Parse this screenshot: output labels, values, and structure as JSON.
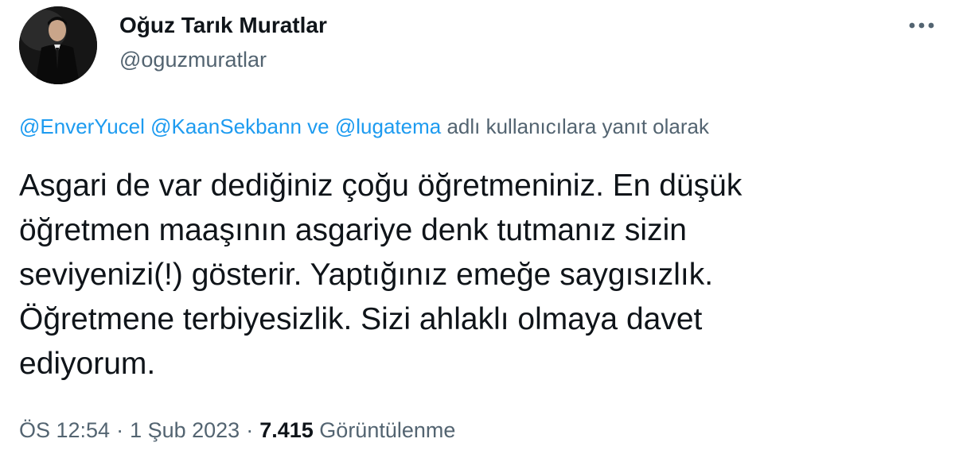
{
  "author": {
    "display_name": "Oğuz Tarık Muratlar",
    "handle": "@oguzmuratlar"
  },
  "menu": {
    "icon": "more-horizontal-icon"
  },
  "reply": {
    "mentions": [
      "@EnverYucel",
      "@KaanSekbann",
      "@lugatema"
    ],
    "connector": "ve",
    "suffix": "adlı kullanıcılara yanıt olarak"
  },
  "tweet": {
    "lines": [
      "Asgari de var dediğiniz çoğu öğretmeniniz. En düşük",
      "öğretmen maaşının asgariye denk tutmanız sizin",
      "seviyenizi(!) gösterir. Yaptığınız emeğe saygısızlık.",
      "Öğretmene terbiyesizlik. Sizi ahlaklı olmaya davet",
      "ediyorum."
    ]
  },
  "meta": {
    "time": "ÖS 12:54",
    "separator": "·",
    "date": "1 Şub 2023",
    "views_count": "7.415",
    "views_label": "Görüntülenme"
  },
  "colors": {
    "text": "#0f1419",
    "secondary": "#536471",
    "link": "#1d9bf0"
  }
}
